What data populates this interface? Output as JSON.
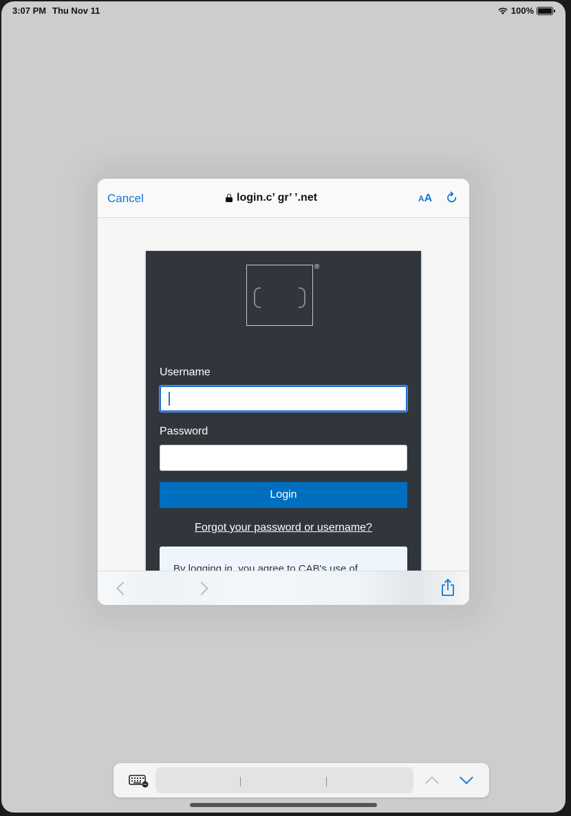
{
  "status_bar": {
    "time": "3:07 PM",
    "date": "Thu Nov 11",
    "battery": "100%"
  },
  "safari_view": {
    "cancel_label": "Cancel",
    "url": "login.c’ gr’ ’.net",
    "text_size_label_small": "A",
    "text_size_label_large": "A"
  },
  "login_form": {
    "brand_mark": "®",
    "username_label": "Username",
    "username_value": "",
    "password_label": "Password",
    "password_value": "",
    "login_button": "Login",
    "forgot_link": "Forgot your password or username?",
    "consent_text": "By logging in, you agree to CAB's use of"
  },
  "colors": {
    "accent": "#1677d2",
    "card_bg": "#30363b",
    "login_button_bg": "#006fbf",
    "focus_border": "#1f6fd1"
  },
  "icons": {
    "lock": "lock-icon",
    "reload": "reload-icon",
    "back": "chevron-left-icon",
    "forward": "chevron-right-icon",
    "share": "share-icon",
    "keyboard": "keyboard-icon",
    "previous_field": "chevron-up-icon",
    "next_field": "chevron-down-icon"
  }
}
